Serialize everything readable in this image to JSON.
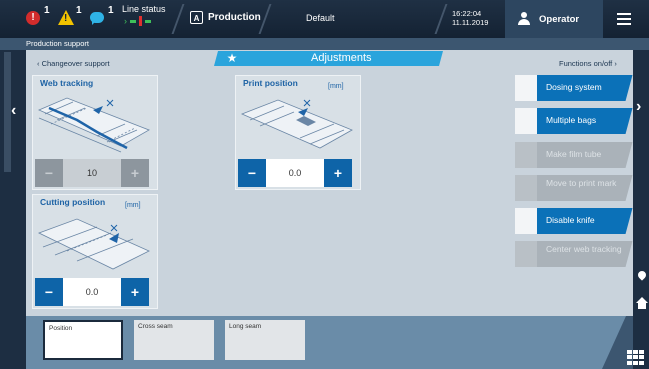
{
  "topbar": {
    "alerts": [
      {
        "icon": "error-icon",
        "count": "1"
      },
      {
        "icon": "warning-icon",
        "count": "1"
      },
      {
        "icon": "message-icon",
        "count": "1"
      }
    ],
    "line_status_label": "Line status",
    "production_label": "Production",
    "default_label": "Default",
    "time": "16:22:04",
    "date": "11.11.2019",
    "operator_label": "Operator"
  },
  "subheader": {
    "title": "Production support"
  },
  "content": {
    "tab_title": "Adjustments",
    "back_link": "‹ Changeover support",
    "functions_link": "Functions on/off ›",
    "cards": {
      "web_tracking": {
        "title": "Web tracking",
        "value": "10"
      },
      "print_position": {
        "title": "Print position",
        "unit": "[mm]",
        "value": "0.0"
      },
      "cutting_position": {
        "title": "Cutting position",
        "unit": "[mm]",
        "value": "0.0"
      }
    },
    "stepper_minus": "−",
    "stepper_plus": "+",
    "functions": [
      {
        "label": "Dosing system",
        "state": "on"
      },
      {
        "label": "Multiple bags",
        "state": "on"
      },
      {
        "label": "Make film tube",
        "state": "disabled"
      },
      {
        "label": "Move to print mark",
        "state": "disabled"
      },
      {
        "label": "Disable knife",
        "state": "on"
      },
      {
        "label": "Center web tracking",
        "state": "disabled"
      }
    ]
  },
  "bottom": {
    "seams": [
      "Position",
      "Cross seam",
      "Long seam"
    ]
  },
  "colors": {
    "accent": "#2aa4dc",
    "active_button": "#0b71b8",
    "title_blue": "#1e63a5"
  }
}
